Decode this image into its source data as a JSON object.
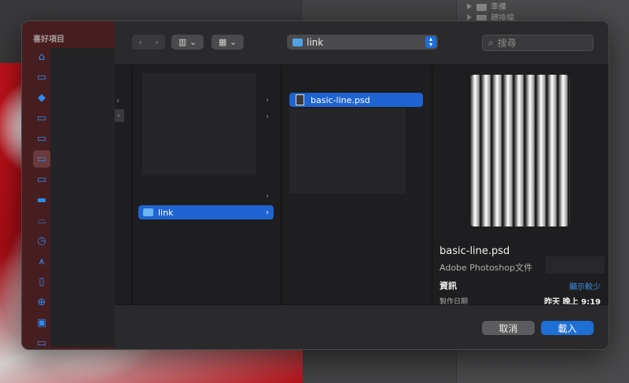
{
  "background": {
    "panel_rows": [
      {
        "label": "準備"
      },
      {
        "label": "轉換檔"
      }
    ]
  },
  "dialog": {
    "sidebar": {
      "title": "喜好項目",
      "icons": [
        {
          "name": "home-icon",
          "glyph": "⌂"
        },
        {
          "name": "folder-icon",
          "glyph": "▭"
        },
        {
          "name": "dropbox-icon",
          "glyph": "◆"
        },
        {
          "name": "folder-icon",
          "glyph": "▭"
        },
        {
          "name": "folder-icon",
          "glyph": "▭"
        },
        {
          "name": "folder-icon",
          "glyph": "▭",
          "selected": true
        },
        {
          "name": "folder-icon",
          "glyph": "▭"
        },
        {
          "name": "monitor-icon",
          "glyph": "▬"
        },
        {
          "name": "drive-icon",
          "glyph": "⌓"
        },
        {
          "name": "recents-icon",
          "glyph": "◷"
        },
        {
          "name": "applications-icon",
          "glyph": "⩚"
        },
        {
          "name": "document-icon",
          "glyph": "▯"
        },
        {
          "name": "download-icon",
          "glyph": "⊕"
        },
        {
          "name": "photos-icon",
          "glyph": "▣"
        },
        {
          "name": "folder-icon",
          "glyph": "▭"
        }
      ]
    },
    "toolbar": {
      "back": "‹",
      "forward": "›",
      "view_glyph": "▥ ⌄",
      "group_glyph": "▦ ⌄",
      "path_label": "link",
      "search_placeholder": "搜尋"
    },
    "columns": {
      "selected_folder": "link",
      "selected_file": "basic-line.psd"
    },
    "preview": {
      "file_name": "basic-line.psd",
      "kind": "Adobe Photoshop文件",
      "info_label": "資訊",
      "show_less": "顯示較少",
      "created_label": "製作日期",
      "created_value": "昨天 晚上 9:19"
    },
    "buttons": {
      "cancel": "取消",
      "open": "載入"
    },
    "colors": {
      "accent": "#1e6fd6",
      "selection": "#1e64d2"
    }
  }
}
